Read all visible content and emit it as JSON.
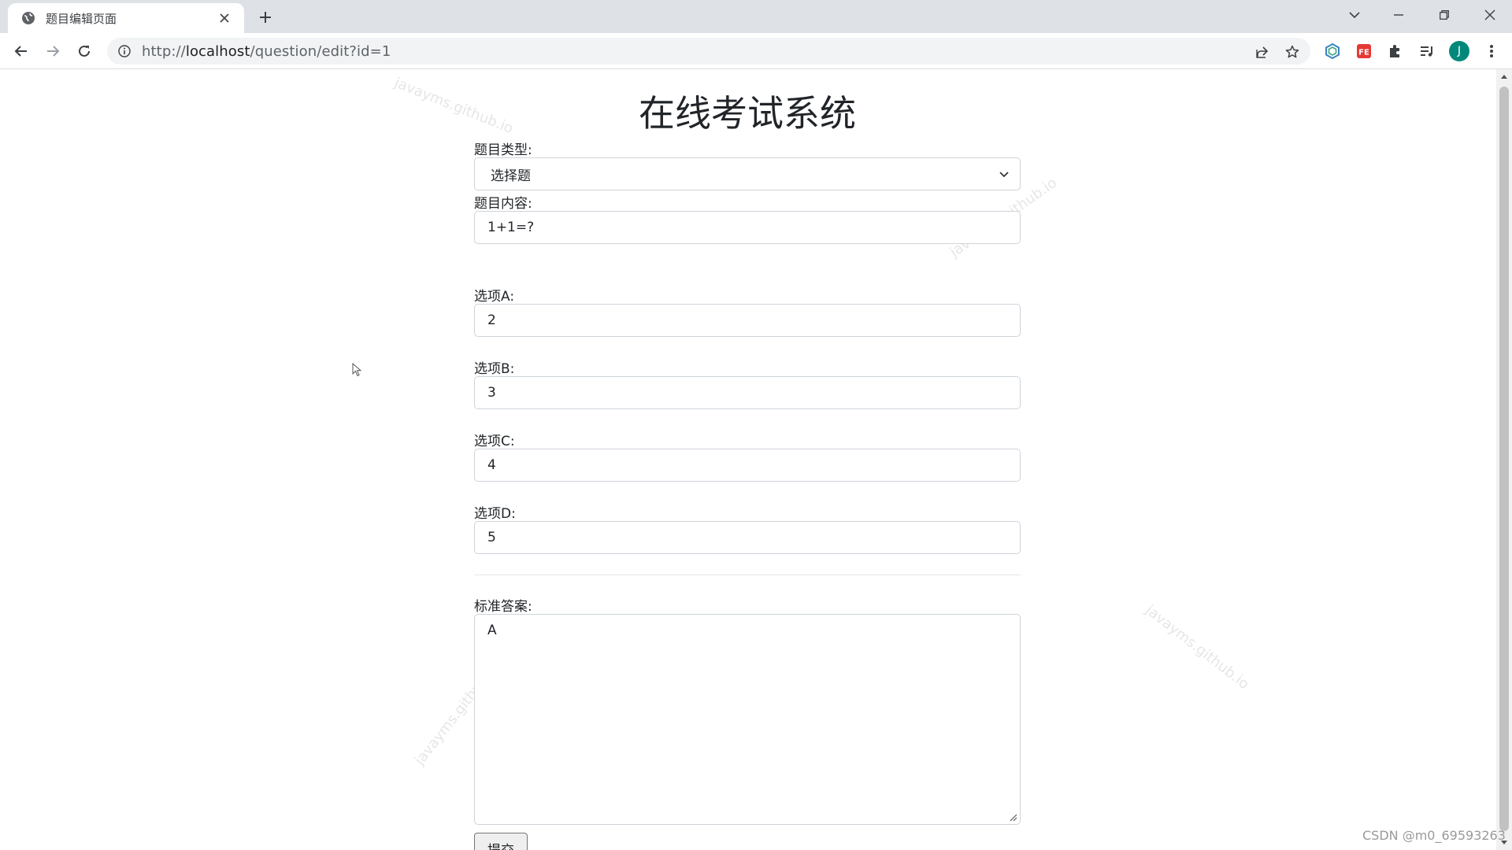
{
  "browser": {
    "tab_title": "题目编辑页面",
    "url_prefix": "http://",
    "url_host": "localhost",
    "url_path": "/question/edit?id=1",
    "profile_initial": "J",
    "colors": {
      "tabbar": "#dee1e6",
      "avatar": "#00897b"
    }
  },
  "page": {
    "title": "在线考试系统"
  },
  "form": {
    "type_label": "题目类型:",
    "type_value": "选择题",
    "content_label": "题目内容:",
    "content_value": "1+1=?",
    "option_a_label": "选项A:",
    "option_a_value": "2",
    "option_b_label": "选项B:",
    "option_b_value": "3",
    "option_c_label": "选项C:",
    "option_c_value": "4",
    "option_d_label": "选项D:",
    "option_d_value": "5",
    "answer_label": "标准答案:",
    "answer_value": "A",
    "submit_label": "提交"
  },
  "watermark_text": "javayms.github.io",
  "footer_credit": "CSDN @m0_69593263"
}
